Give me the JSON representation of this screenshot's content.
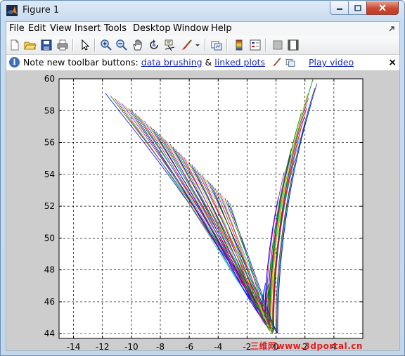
{
  "window": {
    "title": "Figure 1",
    "accent": "#6a8fb6"
  },
  "menu": [
    {
      "label": "File"
    },
    {
      "label": "Edit"
    },
    {
      "label": "View"
    },
    {
      "label": "Insert"
    },
    {
      "label": "Tools"
    },
    {
      "label": "Desktop"
    },
    {
      "label": "Window"
    },
    {
      "label": "Help"
    }
  ],
  "toolbar": {
    "buttons": [
      "new-figure-icon",
      "open-icon",
      "save-icon",
      "print-icon",
      "pointer-icon",
      "zoom-in-icon",
      "zoom-out-icon",
      "pan-icon",
      "rotate-icon",
      "data-cursor-icon",
      "brush-icon",
      "dropdown-icon",
      "link-plot-icon",
      "colorbar-icon",
      "legend-icon",
      "hide-plot-tools-icon",
      "show-plot-tools-icon"
    ]
  },
  "infobar": {
    "text_prefix": "Note new toolbar buttons: ",
    "link_brushing": "data brushing",
    "amp": " & ",
    "link_linked": "linked plots",
    "link_video": "Play video",
    "close": "×"
  },
  "chart_data": {
    "type": "line",
    "title": "",
    "xlabel": "",
    "ylabel": "",
    "xlim": [
      -15,
      6
    ],
    "ylim": [
      43.7,
      60
    ],
    "xticks": [
      -14,
      -12,
      -10,
      -8,
      -6,
      -4,
      -2,
      0,
      2,
      4
    ],
    "yticks": [
      44,
      46,
      48,
      50,
      52,
      54,
      56,
      58,
      60
    ],
    "grid": true,
    "grid_style": "dashed",
    "series_count": 44,
    "description_of_curves": "family of curves; each starts at upper-left (x≈-12..-3, y≈59..52), descends to a minimum near x≈-0.6..0, y≈44..46, then rises; later curves rise steeply to x≈0.3..2.8, y up to 60",
    "colors": [
      "#0000ff",
      "#008000",
      "#ff0000",
      "#00bfbf",
      "#bf00bf",
      "#bfbf00",
      "#404040"
    ]
  },
  "watermark": "三维网www.3dportal.cn"
}
